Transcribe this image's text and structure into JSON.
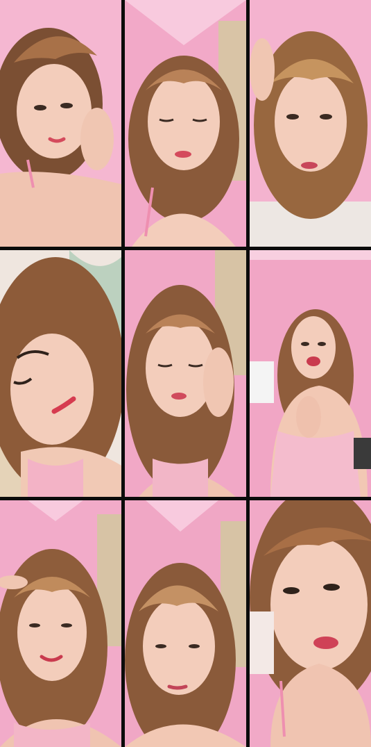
{
  "palette": {
    "wall": "#f2acc9",
    "wall_light": "#f8c7dc",
    "hair": "#8a5a3a",
    "hair_light": "#c49164",
    "skin": "#f3cdbb",
    "skin_shadow": "#e4a996",
    "lips": "#d44a5c",
    "strap": "#ee8fb0",
    "curtain": "#d7c3a5",
    "pillow": "#efe9e3"
  },
  "tiles": [
    {
      "row": 1,
      "col": 1,
      "pose": "lying-hand-on-cheek",
      "has_pillow": true,
      "has_curtain": false
    },
    {
      "row": 1,
      "col": 2,
      "pose": "upright-eyes-closed",
      "has_pillow": false,
      "has_curtain": true
    },
    {
      "row": 1,
      "col": 3,
      "pose": "lying-hand-in-hair",
      "has_pillow": true,
      "has_curtain": false
    },
    {
      "row": 2,
      "col": 1,
      "pose": "tilted-closeup",
      "has_pillow": true,
      "has_curtain": false
    },
    {
      "row": 2,
      "col": 2,
      "pose": "hand-on-cheek",
      "has_pillow": false,
      "has_curtain": true
    },
    {
      "row": 2,
      "col": 3,
      "pose": "standing-wide",
      "has_pillow": false,
      "has_curtain": false
    },
    {
      "row": 3,
      "col": 1,
      "pose": "hand-on-forehead",
      "has_pillow": false,
      "has_curtain": true
    },
    {
      "row": 3,
      "col": 2,
      "pose": "upright-lower-frame",
      "has_pillow": false,
      "has_curtain": true
    },
    {
      "row": 3,
      "col": 3,
      "pose": "close-face",
      "has_pillow": false,
      "has_curtain": false
    }
  ]
}
